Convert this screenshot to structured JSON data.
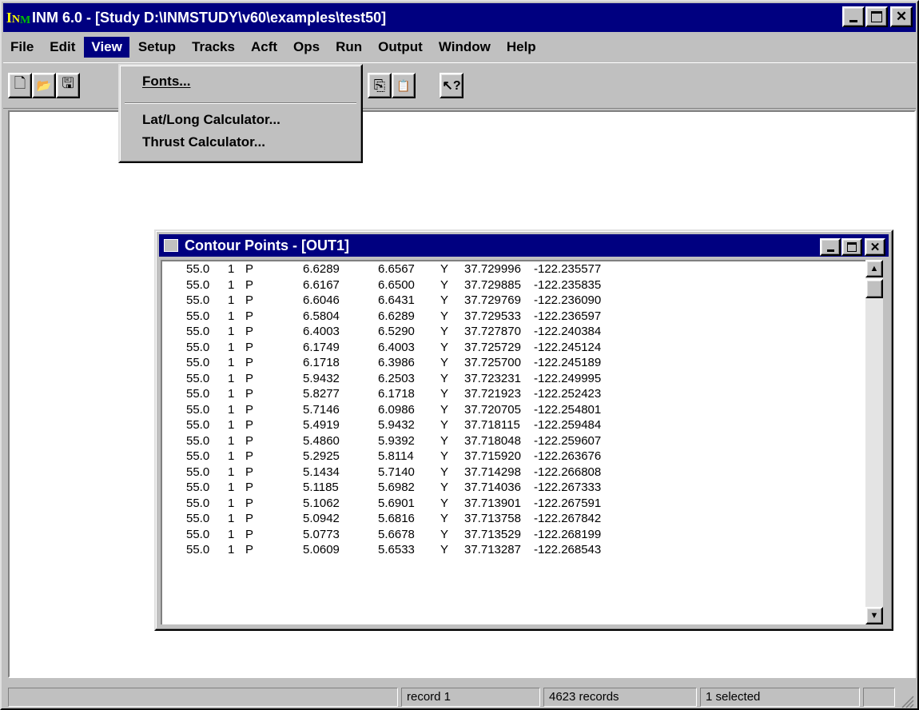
{
  "window": {
    "title": "INM 6.0 - [Study D:\\INMSTUDY\\v60\\examples\\test50]",
    "logo": "NM",
    "minimize_label": "_",
    "maximize_label": "□",
    "close_label": "✕"
  },
  "menubar": {
    "items": [
      {
        "label": "File",
        "active": false
      },
      {
        "label": "Edit",
        "active": false
      },
      {
        "label": "View",
        "active": true
      },
      {
        "label": "Setup",
        "active": false
      },
      {
        "label": "Tracks",
        "active": false
      },
      {
        "label": "Acft",
        "active": false
      },
      {
        "label": "Ops",
        "active": false
      },
      {
        "label": "Run",
        "active": false
      },
      {
        "label": "Output",
        "active": false
      },
      {
        "label": "Window",
        "active": false
      },
      {
        "label": "Help",
        "active": false
      }
    ]
  },
  "toolbar": {
    "buttons": [
      "new-file-icon",
      "open-folder-icon",
      "save-disk-icon",
      "copy-icon",
      "paste-icon",
      "context-help-icon"
    ],
    "new_icon": "🗋",
    "open_icon": "📂",
    "save_icon": "🖫",
    "copy_icon": "⎘",
    "paste_icon": "📋",
    "help_icon": "↖?"
  },
  "view_menu": {
    "items": [
      {
        "label": "Fonts..."
      },
      {
        "label": "Lat/Long Calculator..."
      },
      {
        "label": "Thrust Calculator..."
      }
    ]
  },
  "contour_window": {
    "title": "Contour Points - [OUT1]",
    "scroll_up": "▲",
    "scroll_down": "▼",
    "rows": [
      [
        "55.0",
        "1",
        "P",
        "6.6289",
        "6.6567",
        "Y",
        "37.729996",
        "-122.235577"
      ],
      [
        "55.0",
        "1",
        "P",
        "6.6167",
        "6.6500",
        "Y",
        "37.729885",
        "-122.235835"
      ],
      [
        "55.0",
        "1",
        "P",
        "6.6046",
        "6.6431",
        "Y",
        "37.729769",
        "-122.236090"
      ],
      [
        "55.0",
        "1",
        "P",
        "6.5804",
        "6.6289",
        "Y",
        "37.729533",
        "-122.236597"
      ],
      [
        "55.0",
        "1",
        "P",
        "6.4003",
        "6.5290",
        "Y",
        "37.727870",
        "-122.240384"
      ],
      [
        "55.0",
        "1",
        "P",
        "6.1749",
        "6.4003",
        "Y",
        "37.725729",
        "-122.245124"
      ],
      [
        "55.0",
        "1",
        "P",
        "6.1718",
        "6.3986",
        "Y",
        "37.725700",
        "-122.245189"
      ],
      [
        "55.0",
        "1",
        "P",
        "5.9432",
        "6.2503",
        "Y",
        "37.723231",
        "-122.249995"
      ],
      [
        "55.0",
        "1",
        "P",
        "5.8277",
        "6.1718",
        "Y",
        "37.721923",
        "-122.252423"
      ],
      [
        "55.0",
        "1",
        "P",
        "5.7146",
        "6.0986",
        "Y",
        "37.720705",
        "-122.254801"
      ],
      [
        "55.0",
        "1",
        "P",
        "5.4919",
        "5.9432",
        "Y",
        "37.718115",
        "-122.259484"
      ],
      [
        "55.0",
        "1",
        "P",
        "5.4860",
        "5.9392",
        "Y",
        "37.718048",
        "-122.259607"
      ],
      [
        "55.0",
        "1",
        "P",
        "5.2925",
        "5.8114",
        "Y",
        "37.715920",
        "-122.263676"
      ],
      [
        "55.0",
        "1",
        "P",
        "5.1434",
        "5.7140",
        "Y",
        "37.714298",
        "-122.266808"
      ],
      [
        "55.0",
        "1",
        "P",
        "5.1185",
        "5.6982",
        "Y",
        "37.714036",
        "-122.267333"
      ],
      [
        "55.0",
        "1",
        "P",
        "5.1062",
        "5.6901",
        "Y",
        "37.713901",
        "-122.267591"
      ],
      [
        "55.0",
        "1",
        "P",
        "5.0942",
        "5.6816",
        "Y",
        "37.713758",
        "-122.267842"
      ],
      [
        "55.0",
        "1",
        "P",
        "5.0773",
        "5.6678",
        "Y",
        "37.713529",
        "-122.268199"
      ],
      [
        "55.0",
        "1",
        "P",
        "5.0609",
        "5.6533",
        "Y",
        "37.713287",
        "-122.268543"
      ]
    ]
  },
  "statusbar": {
    "record": "record 1",
    "count": "4623 records",
    "selected": "1 selected"
  }
}
